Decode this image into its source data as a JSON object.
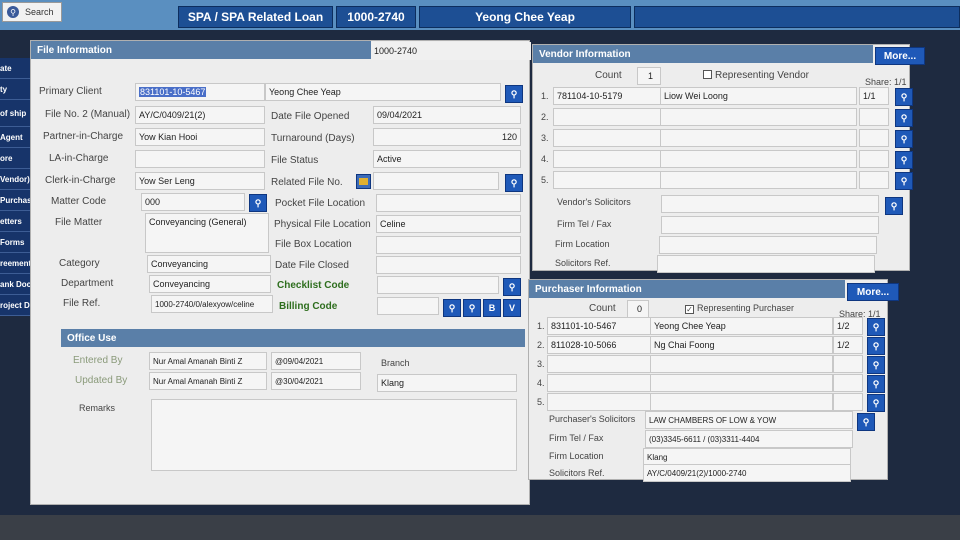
{
  "topbar": {
    "search_label": "Search",
    "tabs": [
      "SPA / SPA Related Loan",
      "1000-2740",
      "Yeong Chee Yeap"
    ]
  },
  "sidenav": {
    "items": [
      "ate",
      "ty",
      "of ship",
      "Agent",
      "ore",
      "Vendor)",
      "Purchaser)",
      "etters",
      "Forms",
      "reements",
      "ank Docs",
      "roject Docs"
    ]
  },
  "file_info": {
    "header": "File Information",
    "header_value": "1000-2740",
    "primary_client_label": "Primary Client",
    "primary_client_id": "831101-10-5467",
    "primary_client_name": "Yeong Chee Yeap",
    "file_no2_label": "File No. 2 (Manual)",
    "file_no2": "AY/C/0409/21(2)",
    "date_opened_label": "Date File Opened",
    "date_opened": "09/04/2021",
    "partner_label": "Partner-in-Charge",
    "partner": "Yow Kian Hooi",
    "turnaround_label": "Turnaround (Days)",
    "turnaround": "120",
    "la_label": "LA-in-Charge",
    "la": "",
    "status_label": "File Status",
    "status": "Active",
    "clerk_label": "Clerk-in-Charge",
    "clerk": "Yow Ser Leng",
    "related_label": "Related File No.",
    "related": "",
    "matter_code_label": "Matter Code",
    "matter_code": "000",
    "pocket_label": "Pocket File Location",
    "pocket": "",
    "file_matter_label": "File Matter",
    "file_matter": "Conveyancing (General)",
    "physical_label": "Physical File Location",
    "physical": "Celine",
    "filebox_label": "File Box Location",
    "filebox": "",
    "category_label": "Category",
    "category": "Conveyancing",
    "date_closed_label": "Date File Closed",
    "date_closed": "",
    "department_label": "Department",
    "department": "Conveyancing",
    "checklist_label": "Checklist Code",
    "checklist": "",
    "file_ref_label": "File Ref.",
    "file_ref": "1000-2740/0/alexyow/celine",
    "billing_label": "Billing Code",
    "billing": "",
    "billing_buttons": [
      "B",
      "V"
    ]
  },
  "office_use": {
    "header": "Office Use",
    "entered_label": "Entered By",
    "entered_by": "Nur Amal Amanah Binti Z",
    "entered_date": "@09/04/2021",
    "branch_label": "Branch",
    "updated_label": "Updated By",
    "updated_by": "Nur Amal Amanah Binti Z",
    "updated_date": "@30/04/2021",
    "branch": "Klang",
    "remarks_label": "Remarks",
    "remarks": ""
  },
  "vendor": {
    "header": "Vendor Information",
    "more": "More...",
    "count_label": "Count",
    "count": "1",
    "representing_label": "Representing Vendor",
    "representing_checked": false,
    "share_label": "Share: 1/1",
    "rows": [
      {
        "num": "1.",
        "id": "781104-10-5179",
        "name": "Liow Wei Loong",
        "share": "1/1"
      },
      {
        "num": "2.",
        "id": "",
        "name": "",
        "share": ""
      },
      {
        "num": "3.",
        "id": "",
        "name": "",
        "share": ""
      },
      {
        "num": "4.",
        "id": "",
        "name": "",
        "share": ""
      },
      {
        "num": "5.",
        "id": "",
        "name": "",
        "share": ""
      }
    ],
    "solicitors_label": "Vendor's Solicitors",
    "solicitors": "",
    "tel_label": "Firm Tel / Fax",
    "tel": "",
    "location_label": "Firm Location",
    "location": "",
    "ref_label": "Solicitors Ref.",
    "ref": ""
  },
  "purchaser": {
    "header": "Purchaser Information",
    "more": "More...",
    "count_label": "Count",
    "count": "0",
    "representing_label": "Representing Purchaser",
    "representing_checked": true,
    "share_label": "Share: 1/1",
    "rows": [
      {
        "num": "1.",
        "id": "831101-10-5467",
        "name": "Yeong Chee Yeap",
        "share": "1/2"
      },
      {
        "num": "2.",
        "id": "811028-10-5066",
        "name": "Ng Chai Foong",
        "share": "1/2"
      },
      {
        "num": "3.",
        "id": "",
        "name": "",
        "share": ""
      },
      {
        "num": "4.",
        "id": "",
        "name": "",
        "share": ""
      },
      {
        "num": "5.",
        "id": "",
        "name": "",
        "share": ""
      }
    ],
    "solicitors_label": "Purchaser's Solicitors",
    "solicitors": "LAW CHAMBERS OF LOW & YOW",
    "tel_label": "Firm Tel / Fax",
    "tel": "(03)3345-6611 / (03)3311-4404",
    "location_label": "Firm Location",
    "location": "Klang",
    "ref_label": "Solicitors Ref.",
    "ref": "AY/C/0409/21(2)/1000-2740"
  }
}
